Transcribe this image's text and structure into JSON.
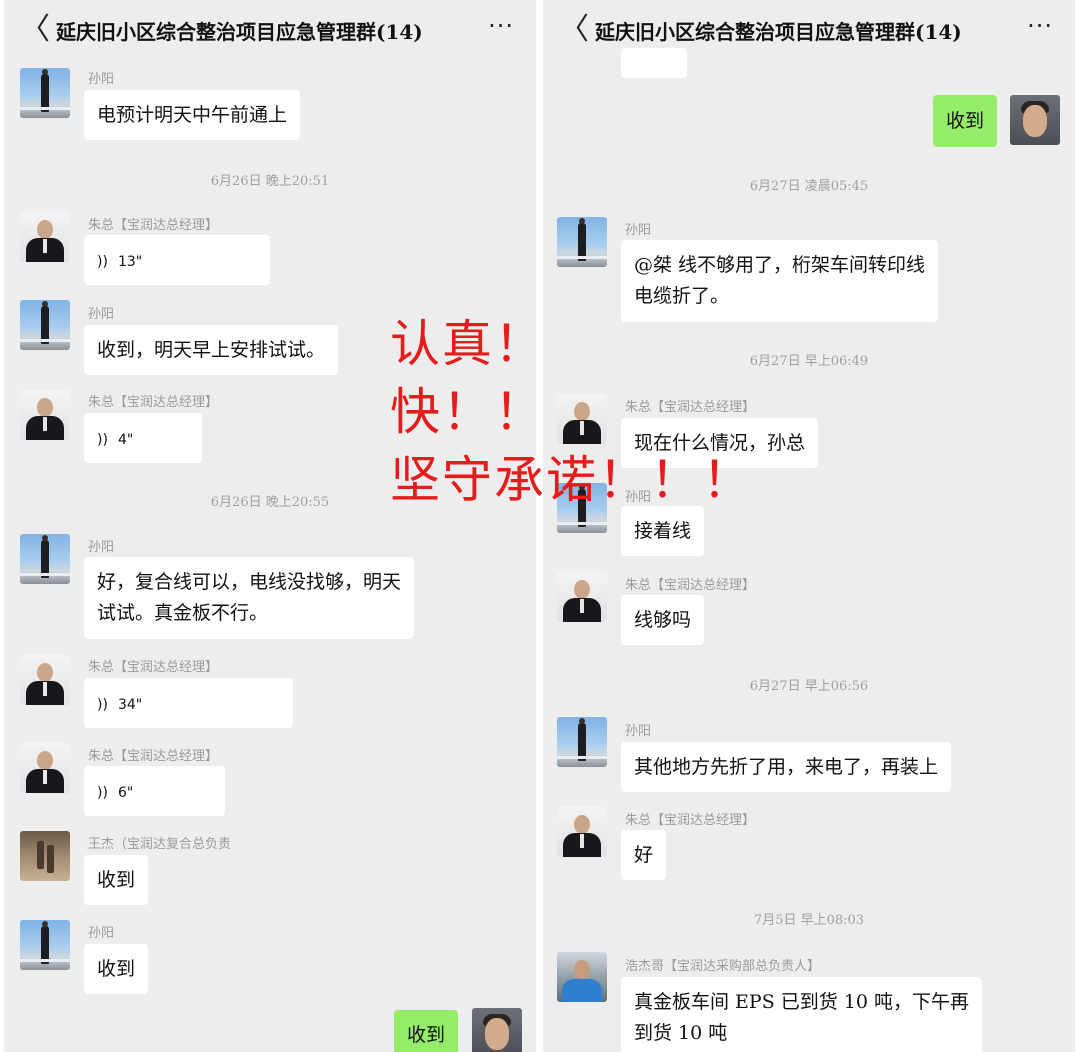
{
  "left_pane": {
    "title": "延庆旧小区综合整治项目应急管理群(14)",
    "back_glyph": "〈",
    "more_glyph": "···",
    "messages": [
      {
        "sender": "孙阳",
        "text": "电预计明天中午前通上"
      },
      {
        "timestamp": "6月26日 晚上20:51"
      },
      {
        "sender": "朱总【宝润达总经理】",
        "voice": "13\""
      },
      {
        "sender": "孙阳",
        "text": "收到，明天早上安排试试。"
      },
      {
        "sender": "朱总【宝润达总经理】",
        "voice": "4\""
      },
      {
        "timestamp": "6月26日 晚上20:55"
      },
      {
        "sender": "孙阳",
        "text": [
          "好，复合线可以，电线没找够，明天",
          "试试。真金板不行。"
        ]
      },
      {
        "sender": "朱总【宝润达总经理】",
        "voice": "34\""
      },
      {
        "sender": "朱总【宝润达总经理】",
        "voice": "6\""
      },
      {
        "sender": "王杰（宝润达复合总负责",
        "text": "收到"
      },
      {
        "sender": "孙阳",
        "text": "收到"
      },
      {
        "self": true,
        "text": "收到"
      }
    ]
  },
  "right_pane": {
    "title": "延庆旧小区综合整治项目应急管理群(14)",
    "back_glyph": "〈",
    "more_glyph": "···",
    "messages": [
      {
        "self": true,
        "text": "收到"
      },
      {
        "timestamp": "6月27日 凌晨05:45"
      },
      {
        "sender": "孙阳",
        "text": [
          "@桀  线不够用了，桁架车间转印线",
          "电缆折了。"
        ]
      },
      {
        "timestamp": "6月27日 早上06:49"
      },
      {
        "sender": "朱总【宝润达总经理】",
        "text": "现在什么情况，孙总"
      },
      {
        "sender": "孙阳",
        "text": "接着线"
      },
      {
        "sender": "朱总【宝润达总经理】",
        "text": "线够吗"
      },
      {
        "timestamp": "6月27日 早上06:56"
      },
      {
        "sender": "孙阳",
        "text": "其他地方先折了用，来电了，再装上"
      },
      {
        "sender": "朱总【宝润达总经理】",
        "text": "好"
      },
      {
        "timestamp": "7月5日 早上08:03"
      },
      {
        "sender": "浩杰哥【宝润达采购部总负责人】",
        "text": [
          "真金板车间 EPS 已到货 10 吨，下午再",
          "到货 10 吨"
        ]
      }
    ]
  },
  "overlay": {
    "lines": [
      "认真！",
      "快！！",
      "坚守承诺！！！"
    ],
    "color": "#e41c1c"
  },
  "colors": {
    "chat_bg": "#ededed",
    "bubble_other": "#ffffff",
    "bubble_self": "#95ec69",
    "timestamp": "#a0a0a0",
    "name": "#9a9a9a"
  },
  "icons": {
    "voice": "))",
    "back": "chevron-left-icon",
    "more": "more-dots-icon"
  }
}
